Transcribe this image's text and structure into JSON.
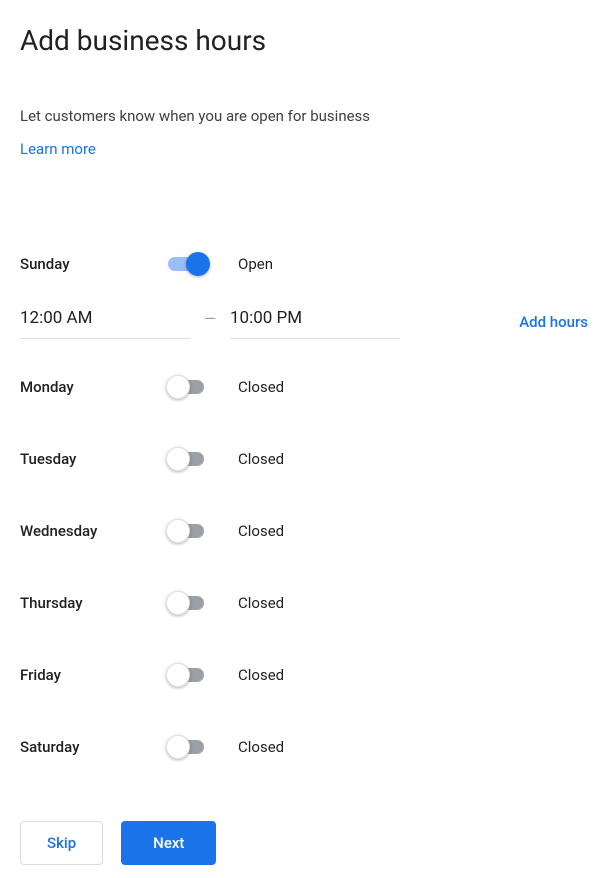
{
  "title": "Add business hours",
  "subtitle": "Let customers know when you are open for business",
  "learn_more": "Learn more",
  "time_separator": "—",
  "add_hours_label": "Add hours",
  "status_open": "Open",
  "status_closed": "Closed",
  "days": {
    "sunday": {
      "label": "Sunday",
      "open": true,
      "from": "12:00 AM",
      "to": "10:00 PM"
    },
    "monday": {
      "label": "Monday",
      "open": false
    },
    "tuesday": {
      "label": "Tuesday",
      "open": false
    },
    "wednesday": {
      "label": "Wednesday",
      "open": false
    },
    "thursday": {
      "label": "Thursday",
      "open": false
    },
    "friday": {
      "label": "Friday",
      "open": false
    },
    "saturday": {
      "label": "Saturday",
      "open": false
    }
  },
  "footer": {
    "skip": "Skip",
    "next": "Next"
  }
}
